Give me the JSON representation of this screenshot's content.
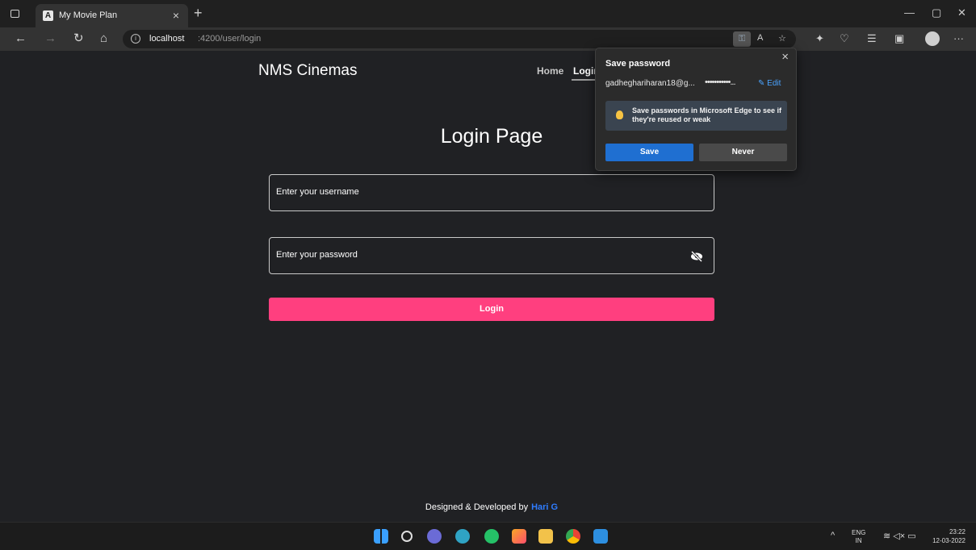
{
  "browser": {
    "tab_title": "My Movie Plan",
    "tab_favicon": "A",
    "tab_close": "×",
    "new_tab": "+",
    "url_host": "localhost",
    "url_path": ":4200/user/login",
    "window_controls": {
      "minimize": "—",
      "maximize": "▢",
      "close": "✕"
    },
    "nav_icons": {
      "back": "←",
      "forward": "→",
      "refresh": "↻",
      "home": "⌂"
    },
    "toolbar_icons": [
      "read-aloud-icon",
      "favorite-icon",
      "extensions-icon",
      "browser-essentials-icon",
      "favorites-icon",
      "collections-icon",
      "profile-icon",
      "more-icon"
    ]
  },
  "app": {
    "brand": "NMS Cinemas",
    "nav": {
      "home": "Home",
      "login": "Login"
    },
    "page_title": "Login Page",
    "form": {
      "username_placeholder": "Enter your username",
      "password_placeholder": "Enter your password",
      "login_label": "Login"
    },
    "footer": {
      "prefix": "Designed & Developed by",
      "author": "Hari G"
    }
  },
  "popup": {
    "title": "Save password",
    "close": "×",
    "username": "gadheghariharan18@g...",
    "password_mask": "•••••••••••...",
    "edit_label": "Edit",
    "tip": "Save passwords in Microsoft Edge to see if they're reused or weak",
    "save_label": "Save",
    "never_label": "Never"
  },
  "taskbar": {
    "apps": [
      "windows-start-icon",
      "search-icon",
      "teams-chat-icon",
      "edge-icon",
      "whatsapp-icon",
      "intellij-icon",
      "file-explorer-icon",
      "chrome-icon",
      "vscode-icon"
    ],
    "tray_caret": "^",
    "language": "ENG",
    "region": "IN",
    "time": "23:22",
    "date": "12-03-2022"
  },
  "colors": {
    "page_bg": "#202124",
    "accent_login": "#ff3f7f",
    "save_blue": "#1f6fd1",
    "author_blue": "#2f7cff"
  }
}
